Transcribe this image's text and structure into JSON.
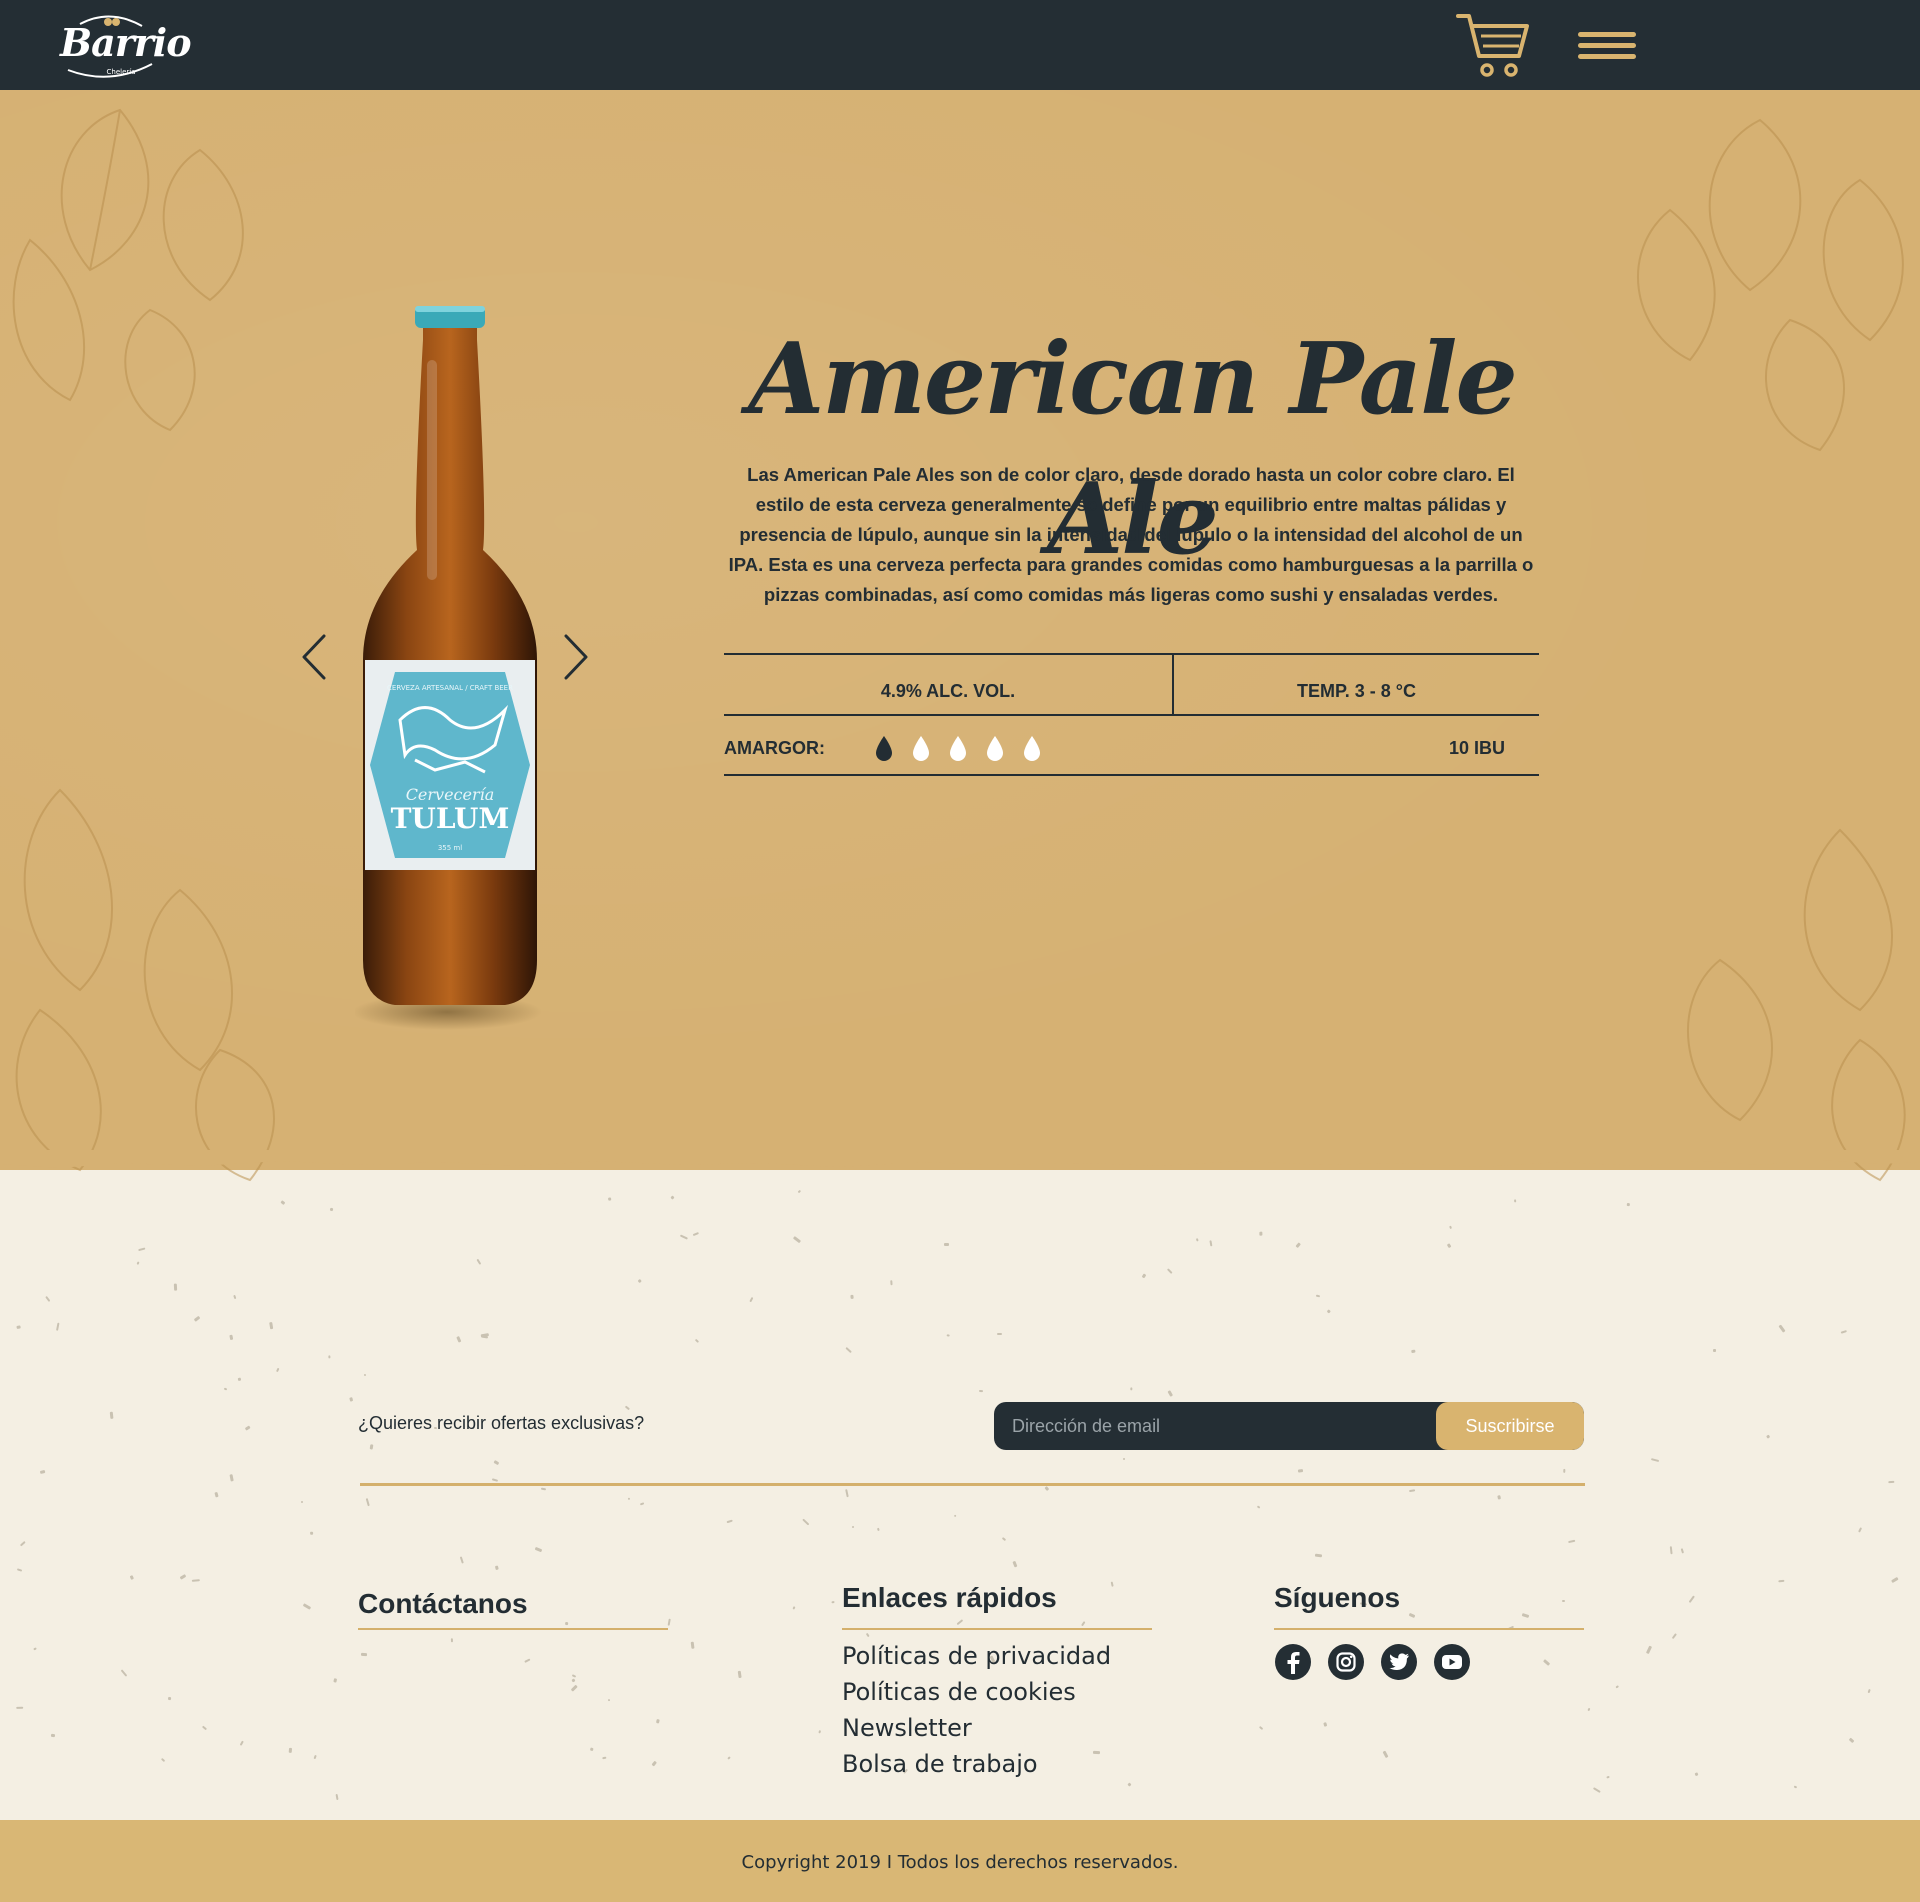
{
  "header": {
    "logo_text": "Barrio",
    "logo_sub": "Chelería"
  },
  "product": {
    "title": "American Pale Ale",
    "description": "Las American Pale Ales son de color claro, desde dorado hasta un color cobre claro. El estilo de esta cerveza generalmente se define por un equilibrio entre maltas pálidas y presencia de lúpulo, aunque sin la intensidad del lúpulo o la intensidad del alcohol de un IPA. Esta es una cerveza perfecta para grandes comidas como hamburguesas a la parrilla o pizzas combinadas, así como comidas más ligeras como sushi y ensaladas verdes.",
    "alcohol": "4.9% ALC. VOL.",
    "temperature": "TEMP. 3 - 8 °C",
    "bitterness_label": "AMARGOR:",
    "bitterness_level": 1,
    "bitterness_max": 5,
    "ibu": "10 IBU",
    "bottle_label_top": "CERVEZA ARTESANAL / CRAFT BEER",
    "bottle_label_brand": "Cervecería",
    "bottle_label_name": "TULUM",
    "bottle_label_volume": "355 ml"
  },
  "newsletter": {
    "question": "¿Quieres recibir ofertas exclusivas?",
    "email_placeholder": "Dirección de email",
    "subscribe_label": "Suscribirse"
  },
  "footer": {
    "contact_title": "Contáctanos",
    "links_title": "Enlaces rápidos",
    "links": [
      "Políticas de privacidad",
      "Políticas de cookies",
      "Newsletter",
      "Bolsa de trabajo"
    ],
    "social_title": "Síguenos",
    "social": [
      "facebook-icon",
      "instagram-icon",
      "twitter-icon",
      "youtube-icon"
    ],
    "copyright": "Copyright 2019 I Todos los derechos reservados."
  },
  "colors": {
    "header_bg": "#242e34",
    "accent_gold": "#d9b46f",
    "hero_bg": "#d6b173",
    "page_bg": "#f4efe3",
    "text_dark": "#232d33"
  }
}
